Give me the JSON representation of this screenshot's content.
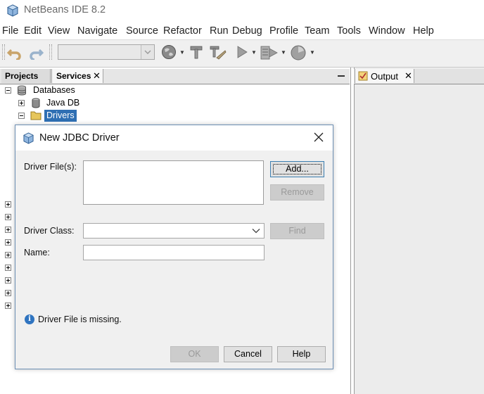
{
  "window": {
    "title": "NetBeans IDE 8.2"
  },
  "menu": [
    "File",
    "Edit",
    "View",
    "Navigate",
    "Source",
    "Refactor",
    "Run",
    "Debug",
    "Profile",
    "Team",
    "Tools",
    "Window",
    "Help"
  ],
  "toolbar": {
    "icons": [
      "undo-icon",
      "redo-icon",
      "config-combo",
      "globe-icon",
      "hammer-icon",
      "clean-build-icon",
      "run-icon",
      "debug-icon",
      "profile-icon"
    ],
    "config_value": ""
  },
  "left_panel": {
    "tabs": [
      {
        "label": "Projects",
        "active": false
      },
      {
        "label": "Services",
        "active": true,
        "close": "✕"
      }
    ],
    "tree": {
      "root": "Databases",
      "children": [
        "Java DB",
        "Drivers"
      ],
      "selected": "Drivers"
    }
  },
  "right_panel": {
    "tabs": [
      {
        "label": "Output",
        "close": "✕"
      }
    ]
  },
  "dialog": {
    "title": "New JDBC Driver",
    "close": "✕",
    "driver_files_label": "Driver File(s):",
    "driver_files": [],
    "add_button": "Add...",
    "remove_button": "Remove",
    "driver_class_label": "Driver Class:",
    "driver_class_value": "",
    "find_button": "Find",
    "name_label": "Name:",
    "name_value": "",
    "message": "Driver File is missing.",
    "ok_button": "OK",
    "cancel_button": "Cancel",
    "help_button": "Help"
  },
  "colors": {
    "selection": "#2f6fb3",
    "info_icon": "#2f74c0",
    "dialog_border": "#6c8fb4"
  }
}
